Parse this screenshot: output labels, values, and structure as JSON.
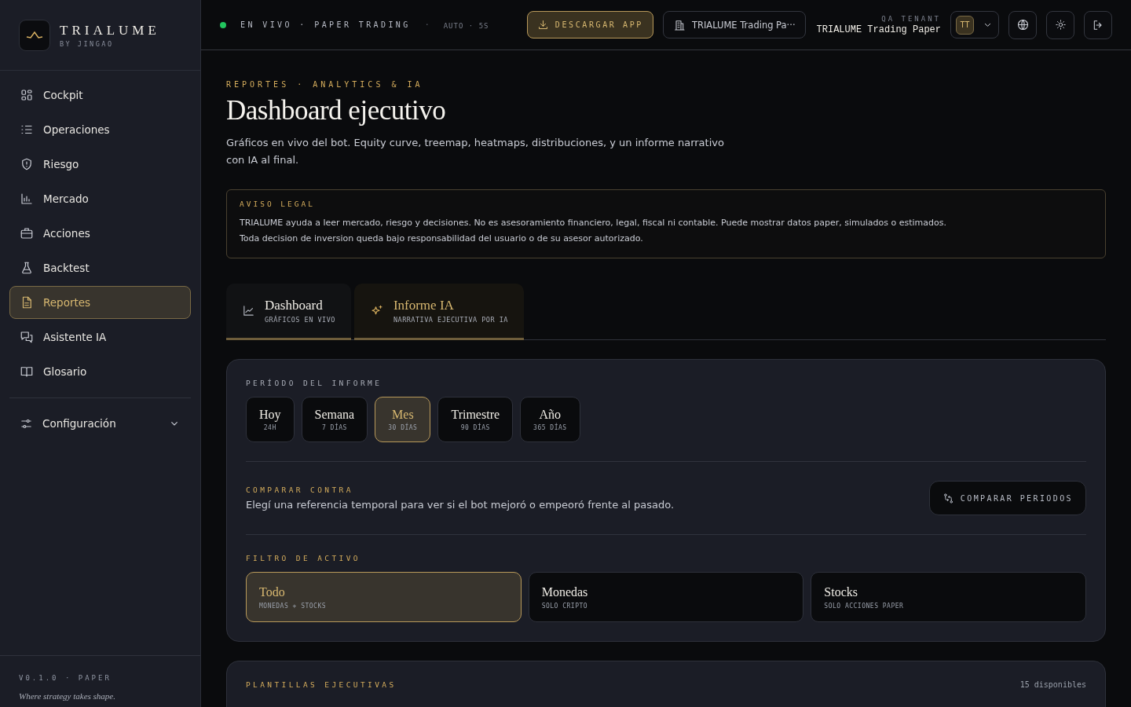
{
  "brand": {
    "name": "TRIALUME",
    "byline": "BY JINGAO"
  },
  "sidebar": {
    "items": [
      {
        "label": "Cockpit",
        "selected": false
      },
      {
        "label": "Operaciones",
        "selected": false
      },
      {
        "label": "Riesgo",
        "selected": false
      },
      {
        "label": "Mercado",
        "selected": false
      },
      {
        "label": "Acciones",
        "selected": false
      },
      {
        "label": "Backtest",
        "selected": false
      },
      {
        "label": "Reportes",
        "selected": true
      },
      {
        "label": "Asistente IA",
        "selected": false
      },
      {
        "label": "Glosario",
        "selected": false
      }
    ],
    "settings": {
      "label": "Configuración",
      "expanded": false
    },
    "version": "V0.1.0 · PAPER",
    "tagline": "Where strategy takes shape."
  },
  "topbar": {
    "status": {
      "live": true,
      "text": "EN VIVO · PAPER TRADING",
      "separator": "·",
      "refresh": "AUTO · 5S"
    },
    "download_button": "DESCARGAR APP",
    "workspace": "TRIALUME Trading Pa···",
    "tenant": {
      "label": "QA TENANT",
      "name": "TRIALUME Trading Paper"
    },
    "avatar": "TT"
  },
  "page": {
    "eyebrow": "REPORTES · ANALYTICS & IA",
    "title": "Dashboard ejecutivo",
    "description": "Gráficos en vivo del bot. Equity curve, treemap, heatmaps, distribuciones, y un informe narrativo con IA al final."
  },
  "notice": {
    "title": "AVISO LEGAL",
    "text": "TRIALUME ayuda a leer mercado, riesgo y decisiones. No es asesoramiento financiero, legal, fiscal ni contable. Puede mostrar datos paper, simulados o estimados. Toda decision de inversion queda bajo responsabilidad del usuario o de su asesor autorizado."
  },
  "tabs": [
    {
      "title": "Dashboard",
      "subtitle": "GRÁFICOS EN VIVO",
      "selected": false
    },
    {
      "title": "Informe IA",
      "subtitle": "NARRATIVA EJECUTIVA POR IA",
      "selected": true
    }
  ],
  "report": {
    "period_label": "PERÍODO DEL INFORME",
    "periods": [
      {
        "label": "Hoy",
        "sub": "24H",
        "selected": false
      },
      {
        "label": "Semana",
        "sub": "7 DÍAS",
        "selected": false
      },
      {
        "label": "Mes",
        "sub": "30 DÍAS",
        "selected": true
      },
      {
        "label": "Trimestre",
        "sub": "90 DÍAS",
        "selected": false
      },
      {
        "label": "Año",
        "sub": "365 DÍAS",
        "selected": false
      }
    ],
    "compare": {
      "label": "COMPARAR CONTRA",
      "text": "Elegí una referencia temporal para ver si el bot mejoró o empeoró frente al pasado.",
      "button": "COMPARAR PERIODOS"
    },
    "filter_label": "FILTRO DE ACTIVO",
    "filters": [
      {
        "label": "Todo",
        "sub": "MONEDAS + STOCKS",
        "selected": true
      },
      {
        "label": "Monedas",
        "sub": "SOLO CRIPTO",
        "selected": false
      },
      {
        "label": "Stocks",
        "sub": "SOLO ACCIONES PAPER",
        "selected": false
      }
    ]
  },
  "templates": {
    "label": "PLANTILLAS EJECUTIVAS",
    "count": "15 disponibles"
  }
}
